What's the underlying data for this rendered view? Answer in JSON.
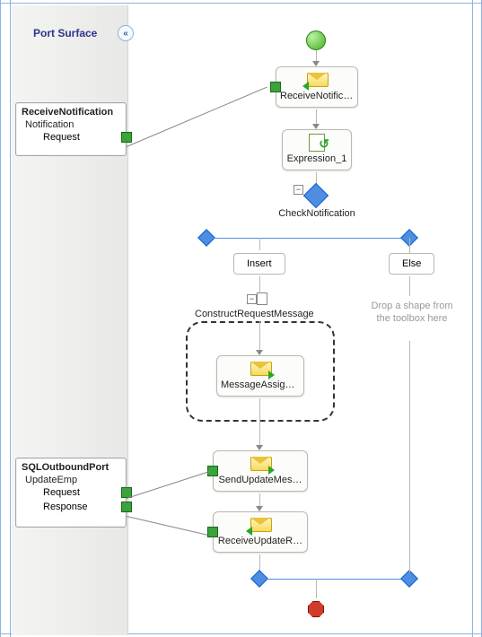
{
  "surface": {
    "title": "Port Surface",
    "collapse_glyph": "«"
  },
  "ports": [
    {
      "name": "ReceiveNotification",
      "operation": "Notification",
      "messages": [
        "Request"
      ]
    },
    {
      "name": "SQLOutboundPort",
      "operation": "UpdateEmp",
      "messages": [
        "Request",
        "Response"
      ]
    }
  ],
  "shapes": {
    "receive_notification": "ReceiveNotificati…",
    "expression_1": "Expression_1",
    "check_notification": "CheckNotification",
    "branch_insert": "Insert",
    "branch_else": "Else",
    "construct_request": "ConstructRequestMessage",
    "message_assign": "MessageAssign…",
    "send_update": "SendUpdateMes…",
    "receive_update": "ReceiveUpdateR…",
    "drop_hint": "Drop a shape from the toolbox here"
  },
  "collapse_glyph": "−"
}
